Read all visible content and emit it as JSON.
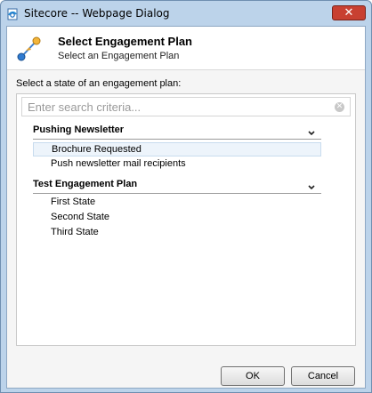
{
  "window": {
    "title": "Sitecore -- Webpage Dialog",
    "close_label": "✕"
  },
  "header": {
    "title": "Select Engagement Plan",
    "subtitle": "Select an Engagement Plan"
  },
  "prompt": "Select a state of an engagement plan:",
  "search": {
    "placeholder": "Enter search criteria...",
    "value": ""
  },
  "groups": [
    {
      "title": "Pushing Newsletter",
      "expanded": true,
      "items": [
        {
          "label": "Brochure Requested",
          "selected": true
        },
        {
          "label": "Push newsletter mail recipients",
          "selected": false
        }
      ]
    },
    {
      "title": "Test Engagement Plan",
      "expanded": true,
      "items": [
        {
          "label": "First State",
          "selected": false
        },
        {
          "label": "Second State",
          "selected": false
        },
        {
          "label": "Third State",
          "selected": false
        }
      ]
    }
  ],
  "buttons": {
    "ok": "OK",
    "cancel": "Cancel"
  },
  "colors": {
    "window_frame": "#bcd3ea",
    "close_button": "#c84031",
    "selected_item_bg": "#edf4fb"
  }
}
